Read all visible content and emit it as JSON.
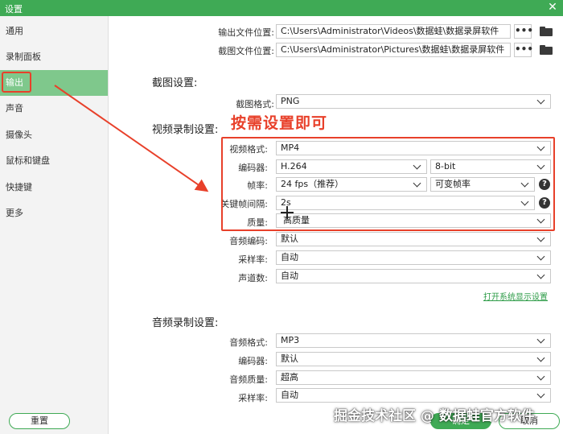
{
  "window": {
    "title": "设置",
    "close_icon": "close-icon"
  },
  "sidebar": {
    "items": [
      {
        "label": "通用",
        "active": false
      },
      {
        "label": "录制面板",
        "active": false
      },
      {
        "label": "输出",
        "active": true
      },
      {
        "label": "声音",
        "active": false
      },
      {
        "label": "摄像头",
        "active": false
      },
      {
        "label": "鼠标和键盘",
        "active": false
      },
      {
        "label": "快捷键",
        "active": false
      },
      {
        "label": "更多",
        "active": false
      }
    ]
  },
  "output_paths": {
    "output_folder_label": "输出文件位置:",
    "output_folder_value": "C:\\Users\\Administrator\\Videos\\数据蛙\\数据录屏软件",
    "screenshot_folder_label": "截图文件位置:",
    "screenshot_folder_value": "C:\\Users\\Administrator\\Pictures\\数据蛙\\数据录屏软件",
    "more_button": "•••"
  },
  "screenshot_settings": {
    "heading": "截图设置:",
    "format_label": "截图格式:",
    "format_value": "PNG"
  },
  "video_settings": {
    "heading": "视频录制设置:",
    "format_label": "视频格式:",
    "format_value": "MP4",
    "encoder_label": "编码器:",
    "encoder_value": "H.264",
    "bitdepth_value": "8-bit",
    "framerate_label": "帧率:",
    "framerate_value": "24 fps（推荐）",
    "framerate_mode_value": "可变帧率",
    "keyframe_label": "关键帧间隔:",
    "keyframe_value": "2s",
    "quality_label": "质量:",
    "quality_value": "高质量",
    "audio_encoder_label": "音频编码:",
    "audio_encoder_value": "默认",
    "sample_rate_label": "采样率:",
    "sample_rate_value": "自动",
    "channels_label": "声道数:",
    "channels_value": "自动",
    "system_display_link": "打开系统显示设置"
  },
  "audio_settings": {
    "heading": "音频录制设置:",
    "format_label": "音频格式:",
    "format_value": "MP3",
    "encoder_label": "编码器:",
    "encoder_value": "默认",
    "quality_label": "音频质量:",
    "quality_value": "超高",
    "sample_rate_label": "采样率:",
    "sample_rate_value": "自动"
  },
  "annotation": {
    "text": "按需设置即可",
    "color": "#e8402a"
  },
  "footer": {
    "reset": "重置",
    "ok": "确定",
    "cancel": "取消"
  },
  "watermark": "掘金技术社区 @ 数据蛙官方软件",
  "colors": {
    "accent": "#3faa55",
    "active_item": "#7fc88c",
    "annotation": "#e8402a"
  }
}
